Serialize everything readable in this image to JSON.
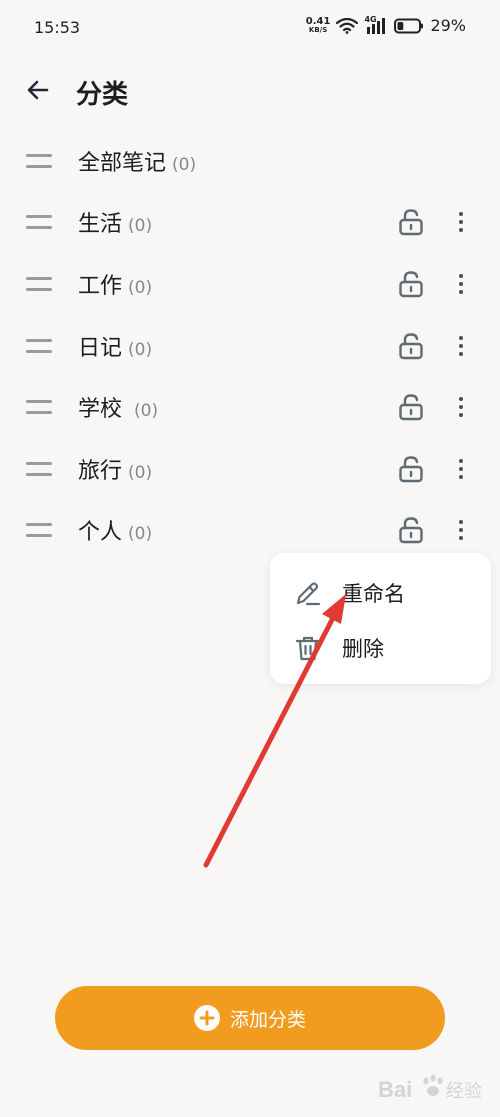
{
  "status_bar": {
    "time": "15:53",
    "net_speed_value": "0.41",
    "net_speed_unit": "KB/S",
    "network_type": "4G",
    "battery_percent": "29%",
    "battery_level": 0.29
  },
  "header": {
    "title": "分类"
  },
  "categories": [
    {
      "name": "全部笔记",
      "count": "(0)",
      "has_actions": false
    },
    {
      "name": "生活",
      "count": "(0)",
      "has_actions": true
    },
    {
      "name": "工作",
      "count": "(0)",
      "has_actions": true
    },
    {
      "name": "日记",
      "count": "(0)",
      "has_actions": true
    },
    {
      "name": "学校",
      "count": "(0)",
      "has_actions": true
    },
    {
      "name": "旅行",
      "count": "(0)",
      "has_actions": true
    },
    {
      "name": "个人",
      "count": "(0)",
      "has_actions": true
    }
  ],
  "popup_menu": {
    "rename_label": "重命名",
    "delete_label": "删除"
  },
  "add_button": {
    "label": "添加分类"
  },
  "colors": {
    "accent": "#f19b1f",
    "background": "#f8f7f5",
    "arrow": "#e03a32",
    "icon_gray": "#5f6b72"
  },
  "watermark": {
    "text": "Bai 经验"
  }
}
